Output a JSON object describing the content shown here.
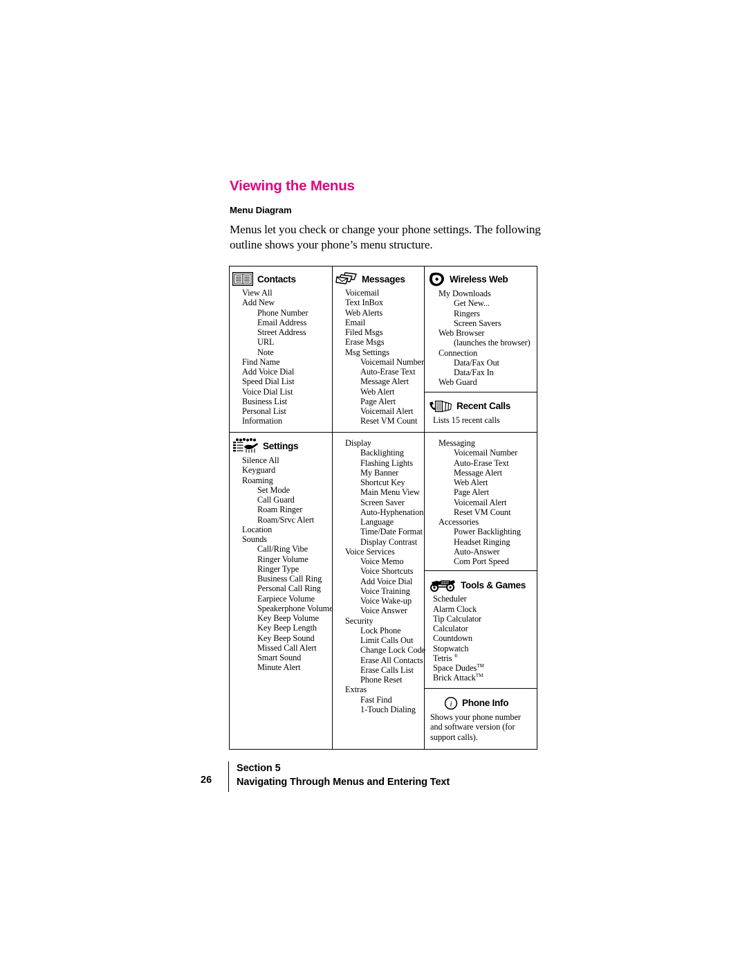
{
  "page": {
    "heading": "Viewing the Menus",
    "subheading": "Menu Diagram",
    "intro": "Menus let you check or change your phone settings. The following outline shows your phone’s menu structure.",
    "heading_color": "#e6007e"
  },
  "diagram": {
    "contacts": {
      "icon": "open-book-icon",
      "title": "Contacts",
      "items": [
        {
          "text": "View All",
          "level": 0
        },
        {
          "text": "Add New",
          "level": 0
        },
        {
          "text": "Phone Number",
          "level": 1
        },
        {
          "text": "Email Address",
          "level": 1
        },
        {
          "text": "Street Address",
          "level": 1
        },
        {
          "text": "URL",
          "level": 1
        },
        {
          "text": "Note",
          "level": 1
        },
        {
          "text": "Find Name",
          "level": 0
        },
        {
          "text": "Add Voice Dial",
          "level": 0
        },
        {
          "text": "Speed Dial List",
          "level": 0
        },
        {
          "text": "Voice Dial List",
          "level": 0
        },
        {
          "text": "Business List",
          "level": 0
        },
        {
          "text": "Personal List",
          "level": 0
        },
        {
          "text": "Information",
          "level": 0
        }
      ]
    },
    "messages": {
      "icon": "envelopes-icon",
      "title": "Messages",
      "items": [
        {
          "text": "Voicemail",
          "level": 0
        },
        {
          "text": "Text InBox",
          "level": 0
        },
        {
          "text": "Web Alerts",
          "level": 0
        },
        {
          "text": "Email",
          "level": 0
        },
        {
          "text": "Filed Msgs",
          "level": 0
        },
        {
          "text": "Erase Msgs",
          "level": 0
        },
        {
          "text": "Msg Settings",
          "level": 0
        },
        {
          "text": "Voicemail Number",
          "level": 1
        },
        {
          "text": "Auto-Erase Text",
          "level": 1
        },
        {
          "text": "Message Alert",
          "level": 1
        },
        {
          "text": "Web Alert",
          "level": 1
        },
        {
          "text": "Page Alert",
          "level": 1
        },
        {
          "text": "Voicemail Alert",
          "level": 1
        },
        {
          "text": "Reset VM Count",
          "level": 1
        }
      ]
    },
    "wireless_web": {
      "icon": "vision-logo-icon",
      "title": "Wireless Web",
      "items": [
        {
          "text": "My Downloads",
          "level": 0
        },
        {
          "text": "Get New...",
          "level": 1
        },
        {
          "text": "Ringers",
          "level": 1
        },
        {
          "text": "Screen Savers",
          "level": 1
        },
        {
          "text": "Web Browser",
          "level": 0
        },
        {
          "text": "(launches the browser)",
          "level": 1
        },
        {
          "text": "Connection",
          "level": 0
        },
        {
          "text": "Data/Fax Out",
          "level": 1
        },
        {
          "text": "Data/Fax In",
          "level": 1
        },
        {
          "text": "Web Guard",
          "level": 0
        }
      ]
    },
    "recent_calls": {
      "icon": "phone-list-icon",
      "title": "Recent Calls",
      "note": "Lists 15 recent calls"
    },
    "settings": {
      "icon": "settings-sliders-icon",
      "title": "Settings",
      "column1": [
        {
          "text": "Silence All",
          "level": 0
        },
        {
          "text": "Keyguard",
          "level": 0
        },
        {
          "text": "Roaming",
          "level": 0
        },
        {
          "text": "Set Mode",
          "level": 1
        },
        {
          "text": "Call Guard",
          "level": 1
        },
        {
          "text": "Roam Ringer",
          "level": 1
        },
        {
          "text": "Roam/Srvc Alert",
          "level": 1
        },
        {
          "text": "Location",
          "level": 0
        },
        {
          "text": "Sounds",
          "level": 0
        },
        {
          "text": "Call/Ring Vibe",
          "level": 1
        },
        {
          "text": "Ringer Volume",
          "level": 1
        },
        {
          "text": "Ringer Type",
          "level": 1
        },
        {
          "text": "Business Call Ring",
          "level": 1
        },
        {
          "text": "Personal Call Ring",
          "level": 1
        },
        {
          "text": "Earpiece Volume",
          "level": 1
        },
        {
          "text": "Speakerphone Volume",
          "level": 1
        },
        {
          "text": "Key Beep Volume",
          "level": 1
        },
        {
          "text": "Key Beep Length",
          "level": 1
        },
        {
          "text": "Key Beep Sound",
          "level": 1
        },
        {
          "text": "Missed Call Alert",
          "level": 1
        },
        {
          "text": "Smart Sound",
          "level": 1
        },
        {
          "text": "Minute Alert",
          "level": 1
        }
      ],
      "column2": [
        {
          "text": "Display",
          "level": 0
        },
        {
          "text": "Backlighting",
          "level": 1
        },
        {
          "text": "Flashing Lights",
          "level": 1
        },
        {
          "text": "My Banner",
          "level": 1
        },
        {
          "text": "Shortcut Key",
          "level": 1
        },
        {
          "text": "Main Menu View",
          "level": 1
        },
        {
          "text": "Screen Saver",
          "level": 1
        },
        {
          "text": "Auto-Hyphenation",
          "level": 1
        },
        {
          "text": "Language",
          "level": 1
        },
        {
          "text": "Time/Date Format",
          "level": 1
        },
        {
          "text": "Display Contrast",
          "level": 1
        },
        {
          "text": "Voice Services",
          "level": 0
        },
        {
          "text": "Voice Memo",
          "level": 1
        },
        {
          "text": "Voice Shortcuts",
          "level": 1
        },
        {
          "text": "Add Voice Dial",
          "level": 1
        },
        {
          "text": "Voice Training",
          "level": 1
        },
        {
          "text": "Voice Wake-up",
          "level": 1
        },
        {
          "text": "Voice Answer",
          "level": 1
        },
        {
          "text": "Security",
          "level": 0
        },
        {
          "text": "Lock Phone",
          "level": 1
        },
        {
          "text": "Limit Calls Out",
          "level": 1
        },
        {
          "text": "Change Lock Code",
          "level": 1
        },
        {
          "text": "Erase All Contacts",
          "level": 1
        },
        {
          "text": "Erase Calls List",
          "level": 1
        },
        {
          "text": "Phone Reset",
          "level": 1
        },
        {
          "text": "Extras",
          "level": 0
        },
        {
          "text": "Fast Find",
          "level": 1
        },
        {
          "text": "1-Touch Dialing",
          "level": 1
        }
      ],
      "column3": [
        {
          "text": "Messaging",
          "level": 0
        },
        {
          "text": "Voicemail Number",
          "level": 1
        },
        {
          "text": "Auto-Erase Text",
          "level": 1
        },
        {
          "text": "Message Alert",
          "level": 1
        },
        {
          "text": "Web Alert",
          "level": 1
        },
        {
          "text": "Page Alert",
          "level": 1
        },
        {
          "text": "Voicemail Alert",
          "level": 1
        },
        {
          "text": "Reset VM Count",
          "level": 1
        },
        {
          "text": "Accessories",
          "level": 0
        },
        {
          "text": "Power Backlighting",
          "level": 1
        },
        {
          "text": "Headset Ringing",
          "level": 1
        },
        {
          "text": "Auto-Answer",
          "level": 1
        },
        {
          "text": "Com Port Speed",
          "level": 1
        }
      ]
    },
    "tools_games": {
      "icon": "motorcycle-tools-icon",
      "title": "Tools & Games",
      "items": [
        {
          "text": "Scheduler",
          "mark": ""
        },
        {
          "text": "Alarm Clock",
          "mark": ""
        },
        {
          "text": "Tip Calculator",
          "mark": ""
        },
        {
          "text": "Calculator",
          "mark": ""
        },
        {
          "text": "Countdown",
          "mark": ""
        },
        {
          "text": "Stopwatch",
          "mark": ""
        },
        {
          "text": "Tetris ",
          "mark": "®"
        },
        {
          "text": "Space Dudes",
          "mark": "TM"
        },
        {
          "text": "Brick Attack",
          "mark": "TM"
        }
      ]
    },
    "phone_info": {
      "icon": "info-circle-icon",
      "title": "Phone Info",
      "note": "Shows your phone number and software version (for support calls)."
    }
  },
  "footer": {
    "page_number": "26",
    "section_line": "Section 5",
    "title_line": "Navigating Through Menus and Entering Text"
  }
}
